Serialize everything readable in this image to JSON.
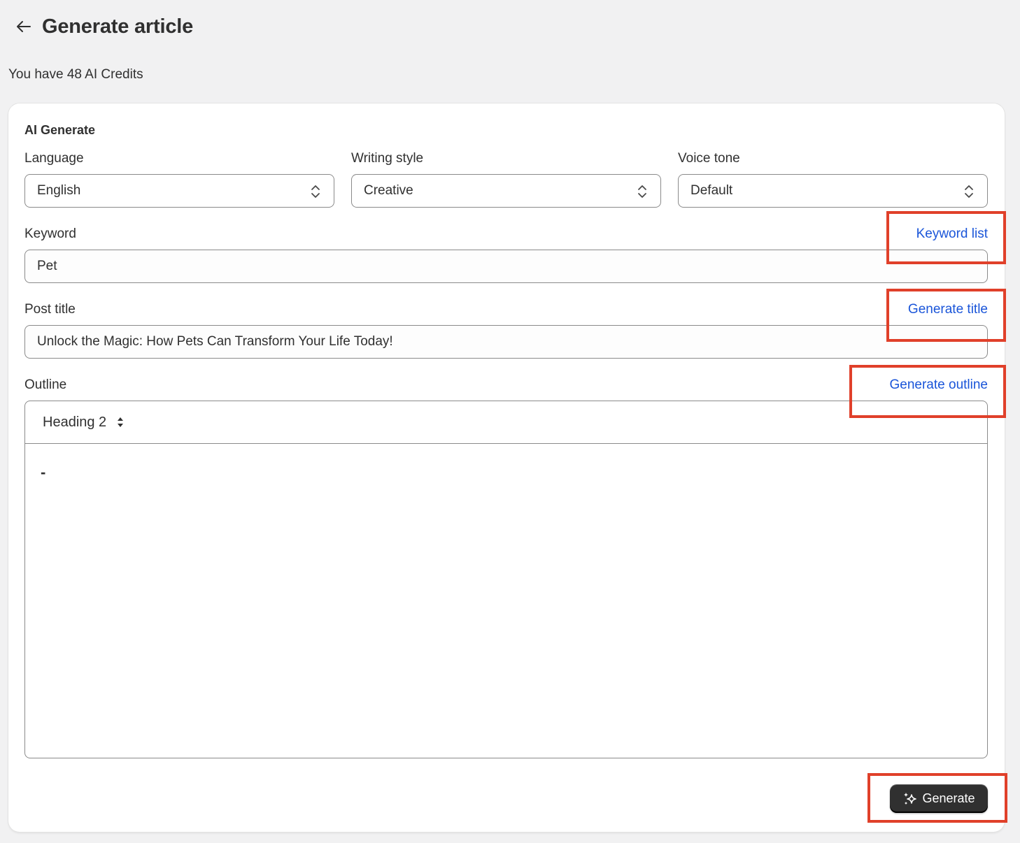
{
  "header": {
    "title": "Generate article",
    "back_icon": "arrow-left-icon"
  },
  "credits_text": "You have 48 AI Credits",
  "card": {
    "title": "AI Generate",
    "language": {
      "label": "Language",
      "value": "English"
    },
    "writing_style": {
      "label": "Writing style",
      "value": "Creative"
    },
    "voice_tone": {
      "label": "Voice tone",
      "value": "Default"
    },
    "keyword": {
      "label": "Keyword",
      "value": "Pet",
      "action": "Keyword list"
    },
    "post_title": {
      "label": "Post title",
      "value": "Unlock the Magic: How Pets Can Transform Your Life Today!",
      "action": "Generate title"
    },
    "outline": {
      "label": "Outline",
      "action": "Generate outline",
      "heading_select": "Heading 2",
      "content": "-"
    },
    "generate_button": "Generate"
  },
  "colors": {
    "link": "#1a55d9",
    "annotation": "#e0402a",
    "primary_button": "#303030"
  }
}
